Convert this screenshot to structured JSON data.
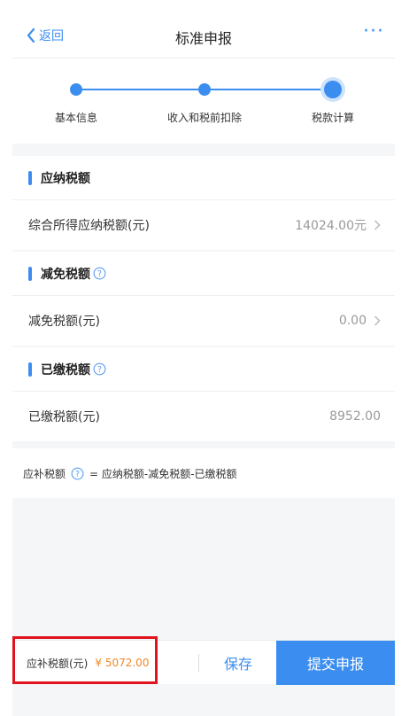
{
  "header": {
    "back_label": "返回",
    "title": "标准申报",
    "more_label": "···"
  },
  "stepper": {
    "steps": [
      {
        "label": "基本信息"
      },
      {
        "label": "收入和税前扣除"
      },
      {
        "label": "税款计算"
      }
    ],
    "current_step": 3
  },
  "sections": [
    {
      "title": "应纳税额",
      "row_label": "综合所得应纳税额(元)",
      "row_value": "14024.00元",
      "has_help": false,
      "has_chevron": true
    },
    {
      "title": "减免税额",
      "row_label": "减免税额(元)",
      "row_value": "0.00",
      "has_help": true,
      "has_chevron": true
    },
    {
      "title": "已缴税额",
      "row_label": "已缴税额(元)",
      "row_value": "8952.00",
      "has_help": true,
      "has_chevron": false
    }
  ],
  "formula": {
    "left": "应补税额",
    "right": "= 应纳税额-减免税额-已缴税额"
  },
  "bottom": {
    "due_label": "应补税额(元)",
    "due_amount": "¥ 5072.00",
    "save_label": "保存",
    "submit_label": "提交申报"
  },
  "colors": {
    "accent": "#3b8ef0",
    "amount": "#f08a24",
    "highlight": "#e0141e"
  }
}
